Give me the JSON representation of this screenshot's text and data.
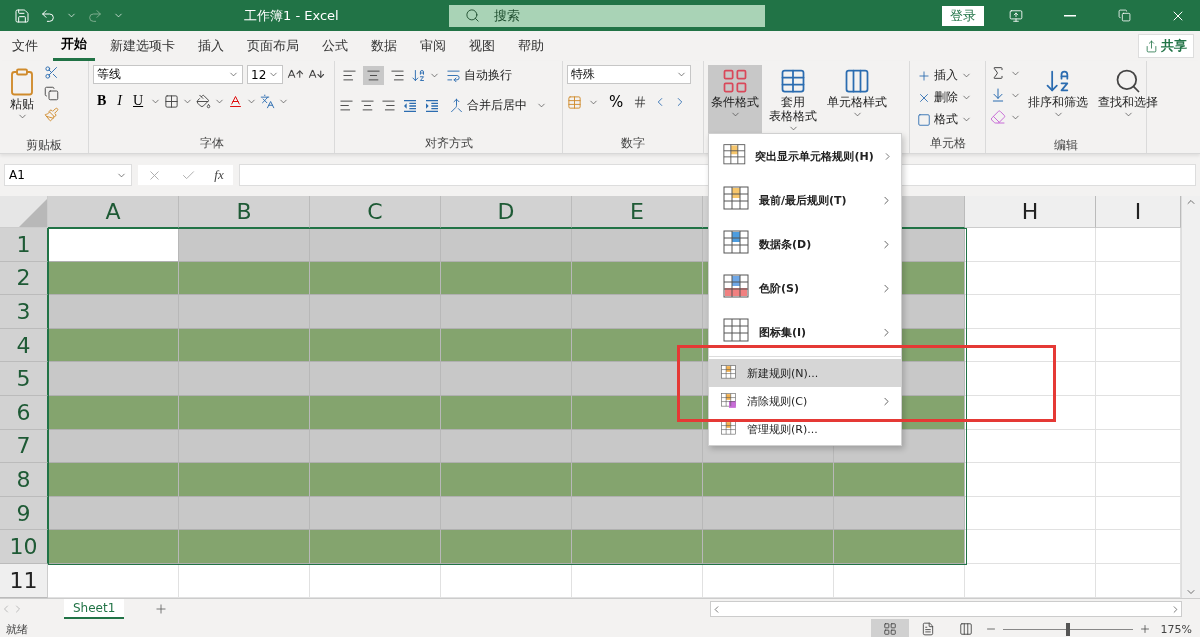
{
  "window": {
    "title": "工作簿1  -  Excel",
    "search": {
      "placeholder": "搜索"
    },
    "sign_in": "登录"
  },
  "tabs": [
    {
      "label": "文件",
      "selected": false
    },
    {
      "label": "开始",
      "selected": true
    },
    {
      "label": "新建选项卡",
      "selected": false
    },
    {
      "label": "插入",
      "selected": false
    },
    {
      "label": "页面布局",
      "selected": false
    },
    {
      "label": "公式",
      "selected": false
    },
    {
      "label": "数据",
      "selected": false
    },
    {
      "label": "审阅",
      "selected": false
    },
    {
      "label": "视图",
      "selected": false
    },
    {
      "label": "帮助",
      "selected": false
    }
  ],
  "share": "共享",
  "ribbon": {
    "clipboard": {
      "label": "剪贴板",
      "paste": "粘贴"
    },
    "font": {
      "label": "字体",
      "font": "等线",
      "size": "12",
      "bold": "B",
      "italic": "I",
      "underline": "U"
    },
    "alignment": {
      "label": "对齐方式",
      "vertical_align": [
        {
          "selected": false
        },
        {
          "selected": true
        },
        {
          "selected": false
        }
      ],
      "wrap": "自动换行",
      "merge": "合并后居中"
    },
    "number": {
      "label": "数字",
      "format": "特殊",
      "percent": "%"
    },
    "styles": [
      {
        "lines": [
          "条件格式"
        ],
        "selected": true
      },
      {
        "lines": [
          "套用",
          "表格格式"
        ],
        "selected": false
      },
      {
        "lines": [
          "单元格样式"
        ],
        "selected": false
      }
    ],
    "cells": {
      "label": "单元格",
      "items": [
        "插入",
        "删除",
        "格式"
      ]
    },
    "editing": {
      "label": "编辑",
      "sort": "排序和筛选",
      "find": "查找和选择"
    }
  },
  "formula_bar": {
    "name_box": "A1",
    "fx": "fx"
  },
  "columns": [
    {
      "label": "A",
      "selected": true
    },
    {
      "label": "B",
      "selected": true
    },
    {
      "label": "C",
      "selected": true
    },
    {
      "label": "D",
      "selected": true
    },
    {
      "label": "E",
      "selected": true
    },
    {
      "selected": true
    },
    {
      "selected": true
    },
    {
      "label": "H",
      "selected": false
    },
    {
      "label": "I",
      "selected": false
    }
  ],
  "rows": [
    {
      "label": "1",
      "selected": true,
      "active": true,
      "color": "#c8c8c8"
    },
    {
      "label": "2",
      "selected": true,
      "active": false,
      "color": "#84a46e"
    },
    {
      "label": "3",
      "selected": true,
      "active": false,
      "color": "#c8c8c8"
    },
    {
      "label": "4",
      "selected": true,
      "active": false,
      "color": "#84a46e"
    },
    {
      "label": "5",
      "selected": true,
      "active": false,
      "color": "#c8c8c8"
    },
    {
      "label": "6",
      "selected": true,
      "active": false,
      "color": "#84a46e"
    },
    {
      "label": "7",
      "selected": true,
      "active": false,
      "color": "#c8c8c8"
    },
    {
      "label": "8",
      "selected": true,
      "active": false,
      "color": "#84a46e"
    },
    {
      "label": "9",
      "selected": true,
      "active": false,
      "color": "#c8c8c8"
    },
    {
      "label": "10",
      "selected": true,
      "active": false,
      "color": "#84a46e"
    },
    {
      "label": "11",
      "selected": false
    }
  ],
  "menu": [
    {
      "label": "突出显示单元格规则(H)",
      "kind": "large",
      "submenu": true,
      "selected": false
    },
    {
      "label": "最前/最后规则(T)",
      "kind": "large",
      "submenu": true,
      "selected": false
    },
    {
      "label": "数据条(D)",
      "kind": "large",
      "submenu": true,
      "selected": false
    },
    {
      "label": "色阶(S)",
      "kind": "large",
      "submenu": true,
      "selected": false
    },
    {
      "label": "图标集(I)",
      "kind": "large",
      "submenu": true,
      "selected": false
    },
    {
      "label": "新建规则(N)...",
      "kind": "small",
      "submenu": false,
      "selected": true
    },
    {
      "label": "清除规则(C)",
      "kind": "small",
      "submenu": true,
      "selected": false
    },
    {
      "label": "管理规则(R)...",
      "kind": "small",
      "submenu": false,
      "selected": false
    }
  ],
  "sheets": [
    {
      "label": "Sheet1",
      "selected": true
    }
  ],
  "status_bar": {
    "status": "就绪",
    "zoom": "175%",
    "zoom_slider": {
      "level": 0.5
    }
  }
}
